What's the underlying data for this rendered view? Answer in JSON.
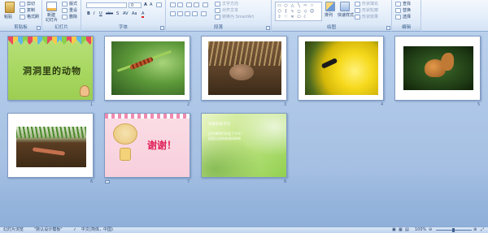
{
  "ribbon": {
    "groups": [
      {
        "id": "clipboard",
        "label": "剪贴板"
      },
      {
        "id": "slides",
        "label": "幻灯片"
      },
      {
        "id": "font",
        "label": "字体"
      },
      {
        "id": "paragraph",
        "label": "段落"
      },
      {
        "id": "drawing",
        "label": "绘图"
      },
      {
        "id": "editing",
        "label": "编辑"
      }
    ],
    "clipboard": {
      "paste": "粘贴",
      "cut": "剪切",
      "copy": "复制",
      "format_painter": "格式刷"
    },
    "slides": {
      "new_slide": "新建",
      "new_slide_line2": "幻灯片",
      "layout": "版式",
      "reset": "重设",
      "delete": "删除"
    },
    "font": {
      "font_size": "0"
    },
    "paragraph": {
      "text_direction": "文字方向",
      "align_text": "对齐文本",
      "smartart": "转换为 SmartArt"
    },
    "drawing": {
      "arrange": "排列",
      "quick_styles": "快速样式",
      "shape_fill": "形状填充",
      "shape_outline": "形状轮廓",
      "shape_effects": "形状效果"
    },
    "editing": {
      "find": "查找",
      "replace": "替换",
      "select": "选择"
    }
  },
  "slides": [
    {
      "number": "1",
      "title": "洞洞里的动物"
    },
    {
      "number": "2"
    },
    {
      "number": "3"
    },
    {
      "number": "4"
    },
    {
      "number": "5"
    },
    {
      "number": "6"
    },
    {
      "number": "7",
      "title": "谢谢！"
    },
    {
      "number": "8",
      "lines": [
        "亲爱的孩子们",
        "这节课你们学会了什么？",
        "回家后说给爸爸妈妈听"
      ]
    }
  ],
  "status_bar": {
    "view": "幻灯片浏览",
    "theme": "\"默认设计模板\"",
    "language": "中文(简体，中国)",
    "zoom": "100%"
  },
  "colors": {
    "ribbon_bg": "#e4eefa",
    "workspace_bg": "#a8c2e4",
    "accent": "#2b579a"
  }
}
